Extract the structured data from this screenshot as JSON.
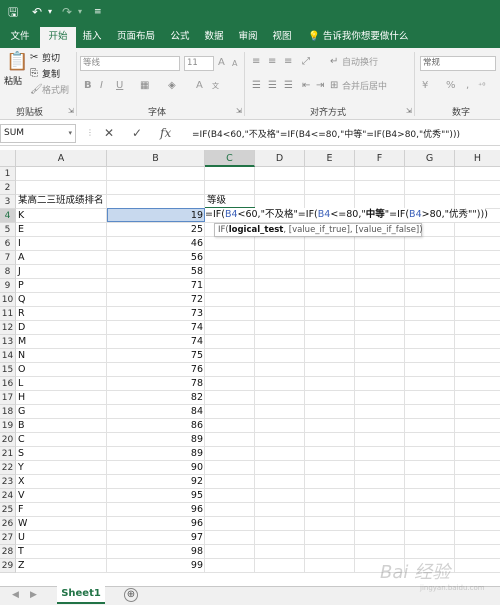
{
  "titlebar": {
    "save_icon": "save-icon",
    "undo_icon": "undo-icon",
    "redo_icon": "redo-icon",
    "customize_icon": "customize-icon"
  },
  "ribbon_tabs": [
    "文件",
    "开始",
    "插入",
    "页面布局",
    "公式",
    "数据",
    "审阅",
    "视图"
  ],
  "active_tab": "开始",
  "tell_me": "告诉我你想要做什么",
  "clipboard": {
    "paste": "粘贴",
    "cut": "剪切",
    "copy": "复制",
    "format_painter": "格式刷",
    "label": "剪贴板"
  },
  "font": {
    "name": "等线",
    "size": "11",
    "grow": "A",
    "shrink": "A",
    "bold": "B",
    "italic": "I",
    "underline": "U",
    "color": "A",
    "label": "字体"
  },
  "alignment": {
    "wrap": "自动换行",
    "merge": "合并后居中",
    "label": "对齐方式"
  },
  "number": {
    "format": "常规",
    "currency": "¥",
    "percent": "%",
    "comma": ",",
    "label": "数字"
  },
  "formula_bar": {
    "name_box": "SUM",
    "cancel": "✕",
    "confirm": "✓",
    "fx": "fx",
    "formula": "=IF(B4<60,\"不及格\"=IF(B4<=80,\"中等\"=IF(B4>80,\"优秀\"\")))"
  },
  "columns": [
    "A",
    "B",
    "C",
    "D",
    "E",
    "F",
    "G",
    "H"
  ],
  "selected_column": "C",
  "selected_row": "4",
  "cells": {
    "A3": "某高二三班成绩排名",
    "C3": "等级"
  },
  "rows": [
    {
      "name": "K",
      "score": "19"
    },
    {
      "name": "E",
      "score": "25"
    },
    {
      "name": "I",
      "score": "46"
    },
    {
      "name": "A",
      "score": "56"
    },
    {
      "name": "J",
      "score": "58"
    },
    {
      "name": "P",
      "score": "71"
    },
    {
      "name": "Q",
      "score": "72"
    },
    {
      "name": "R",
      "score": "73"
    },
    {
      "name": "D",
      "score": "74"
    },
    {
      "name": "M",
      "score": "74"
    },
    {
      "name": "N",
      "score": "75"
    },
    {
      "name": "O",
      "score": "76"
    },
    {
      "name": "L",
      "score": "78"
    },
    {
      "name": "H",
      "score": "82"
    },
    {
      "name": "G",
      "score": "84"
    },
    {
      "name": "B",
      "score": "86"
    },
    {
      "name": "C",
      "score": "89"
    },
    {
      "name": "S",
      "score": "89"
    },
    {
      "name": "Y",
      "score": "90"
    },
    {
      "name": "X",
      "score": "92"
    },
    {
      "name": "V",
      "score": "95"
    },
    {
      "name": "F",
      "score": "96"
    },
    {
      "name": "W",
      "score": "96"
    },
    {
      "name": "U",
      "score": "97"
    },
    {
      "name": "T",
      "score": "98"
    },
    {
      "name": "Z",
      "score": "99"
    }
  ],
  "edit_cell": {
    "p1": "=IF(",
    "r1": "B4",
    "p2": "<60,\"不及格\"=IF(",
    "r2": "B4",
    "p3": "<=80,\"",
    "bold": "中等",
    "p4": "\"=IF(",
    "r3": "B4",
    "p5": ">80,\"优秀\"\")))"
  },
  "tooltip": {
    "fn": "IF(",
    "arg1": "logical_test",
    "rest": ", [value_if_true], [value_if_false])"
  },
  "sheet_tab": "Sheet1",
  "add_sheet": "⊕",
  "watermark": "Bai 经验",
  "watermark_sub": "jingyan.baidu.com"
}
